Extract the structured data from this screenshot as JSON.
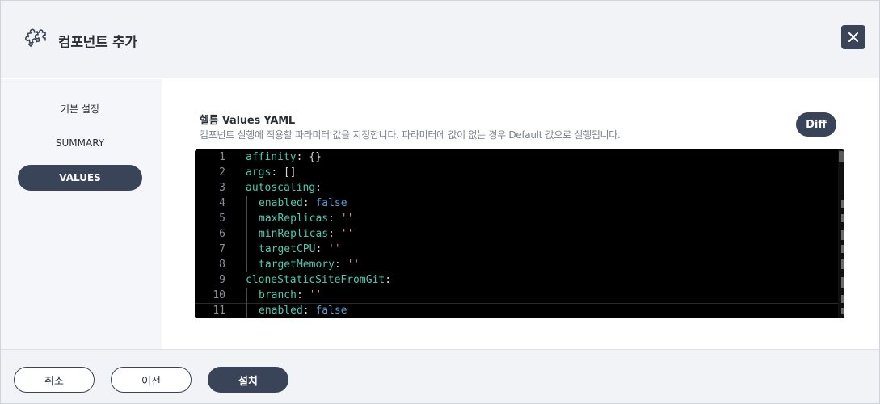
{
  "header": {
    "title": "컴포넌트 추가",
    "icon": "puzzle-icon",
    "close_icon": "close-icon"
  },
  "sidebar": {
    "items": [
      {
        "label": "기본 설정",
        "active": false
      },
      {
        "label": "SUMMARY",
        "active": false
      },
      {
        "label": "VALUES",
        "active": true
      }
    ]
  },
  "main": {
    "title": "헬름 Values YAML",
    "description": "컴포넌트 실행에 적용할 파라미터 값을 지정합니다. 파라미터에 값이 없는 경우 Default 값으로 실행됩니다.",
    "diff_label": "Diff"
  },
  "editor": {
    "lines": [
      {
        "num": "1",
        "key": "affinity",
        "value": "{}",
        "value_type": "punct",
        "indent": 0
      },
      {
        "num": "2",
        "key": "args",
        "value": "[]",
        "value_type": "punct",
        "indent": 0
      },
      {
        "num": "3",
        "key": "autoscaling",
        "value": "",
        "value_type": "none",
        "indent": 0
      },
      {
        "num": "4",
        "key": "enabled",
        "value": "false",
        "value_type": "bool",
        "indent": 1
      },
      {
        "num": "5",
        "key": "maxReplicas",
        "value": "''",
        "value_type": "string",
        "indent": 1
      },
      {
        "num": "6",
        "key": "minReplicas",
        "value": "''",
        "value_type": "string",
        "indent": 1
      },
      {
        "num": "7",
        "key": "targetCPU",
        "value": "''",
        "value_type": "string",
        "indent": 1
      },
      {
        "num": "8",
        "key": "targetMemory",
        "value": "''",
        "value_type": "string",
        "indent": 1
      },
      {
        "num": "9",
        "key": "cloneStaticSiteFromGit",
        "value": "",
        "value_type": "none",
        "indent": 0
      },
      {
        "num": "10",
        "key": "branch",
        "value": "''",
        "value_type": "string",
        "indent": 1
      },
      {
        "num": "11",
        "key": "enabled",
        "value": "false",
        "value_type": "bool",
        "indent": 1,
        "current": true
      }
    ],
    "colors": {
      "key": "#4ec9b0",
      "bool": "#569cd6",
      "string": "#ce9178",
      "punct": "#d4d4d4",
      "background": "#000000"
    }
  },
  "footer": {
    "cancel_label": "취소",
    "prev_label": "이전",
    "install_label": "설치"
  },
  "theme": {
    "primary": "#3a4458",
    "header_bg": "#f1f3f6"
  }
}
